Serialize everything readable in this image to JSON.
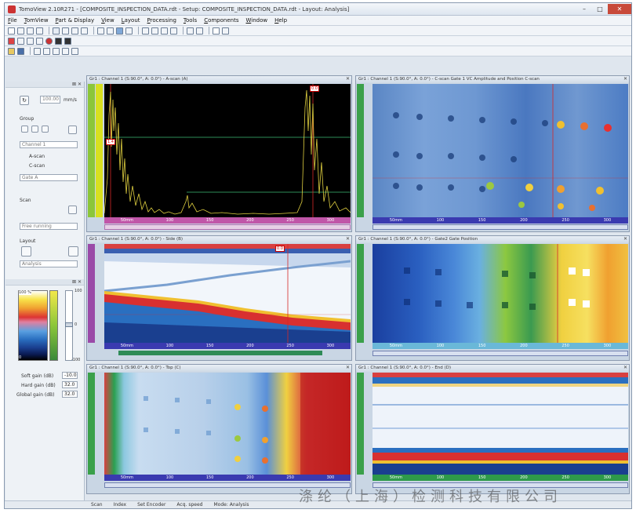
{
  "window": {
    "title": "TomoView 2.10R271 - [COMPOSITE_INSPECTION_DATA.rdt - Setup: COMPOSITE_INSPECTION_DATA.rdt - Layout: Analysis]",
    "minimize": "–",
    "maximize": "□",
    "close": "✕"
  },
  "menu": [
    "File",
    "TomView",
    "Part & Display",
    "View",
    "Layout",
    "Processing",
    "Tools",
    "Components",
    "Window",
    "Help"
  ],
  "left_panel": {
    "group_label": "Group",
    "channel": "Channel 1",
    "ascan_label": "A-scan",
    "cscan_label": "C-scan",
    "gate": "Gate A",
    "scan_label": "Scan",
    "scan_mode": "Free running",
    "layout_label": "Layout",
    "layout_value": "Analysis",
    "speed_value": "100.00",
    "speed_unit": "mm/s",
    "palette_top": "100 %",
    "palette_bottom": "0",
    "gain_scale_top": "100",
    "gain_scale_mid": "0",
    "gain_scale_bottom": "-100",
    "soft_gain_label": "Soft gain (dB)",
    "soft_gain_value": "-10.0",
    "hard_gain_label": "Hard gain (dB)",
    "hard_gain_value": "32.0",
    "global_gain_label": "Global gain (dB)",
    "global_gain_value": "32.0"
  },
  "views": {
    "ascan": {
      "title": "Gr1 : Channel 1 (S:90.0°, A: 0.0°) - A-scan (A)"
    },
    "cscan1": {
      "title": "Gr1 : Channel 1 (S:90.0°, A: 0.0°) - C-scan Gate 1 VC Amplitude and Position C-scan"
    },
    "side": {
      "title": "Gr1 : Channel 1 (S:90.0°, A: 0.0°) - Side (B)"
    },
    "cscan2": {
      "title": "Gr1 : Channel 1 (S:90.0°, A: 0.0°) - Gate2 Gate Position"
    },
    "top": {
      "title": "Gr1 : Channel 1 (S:90.0°, A: 0.0°) - Top (C)"
    },
    "end": {
      "title": "Gr1 : Channel 1 (S:90.0°, A: 0.0°) - End (D)"
    },
    "ticks": [
      "50mm",
      "100",
      "150",
      "200",
      "250",
      "300",
      "350"
    ]
  },
  "status": {
    "scan": "Scan",
    "idx": "Index",
    "set_encoder": "Set Encoder",
    "acq_speed": "Acq. speed",
    "mode": "Mode: Analysis"
  },
  "watermark": "涤纶（上海）检测科技有限公司",
  "colors": {
    "ascan_bg": "#000000",
    "signal": "#e0d040",
    "gate_green": "#2e8b57",
    "cursor_red": "#d62828"
  }
}
